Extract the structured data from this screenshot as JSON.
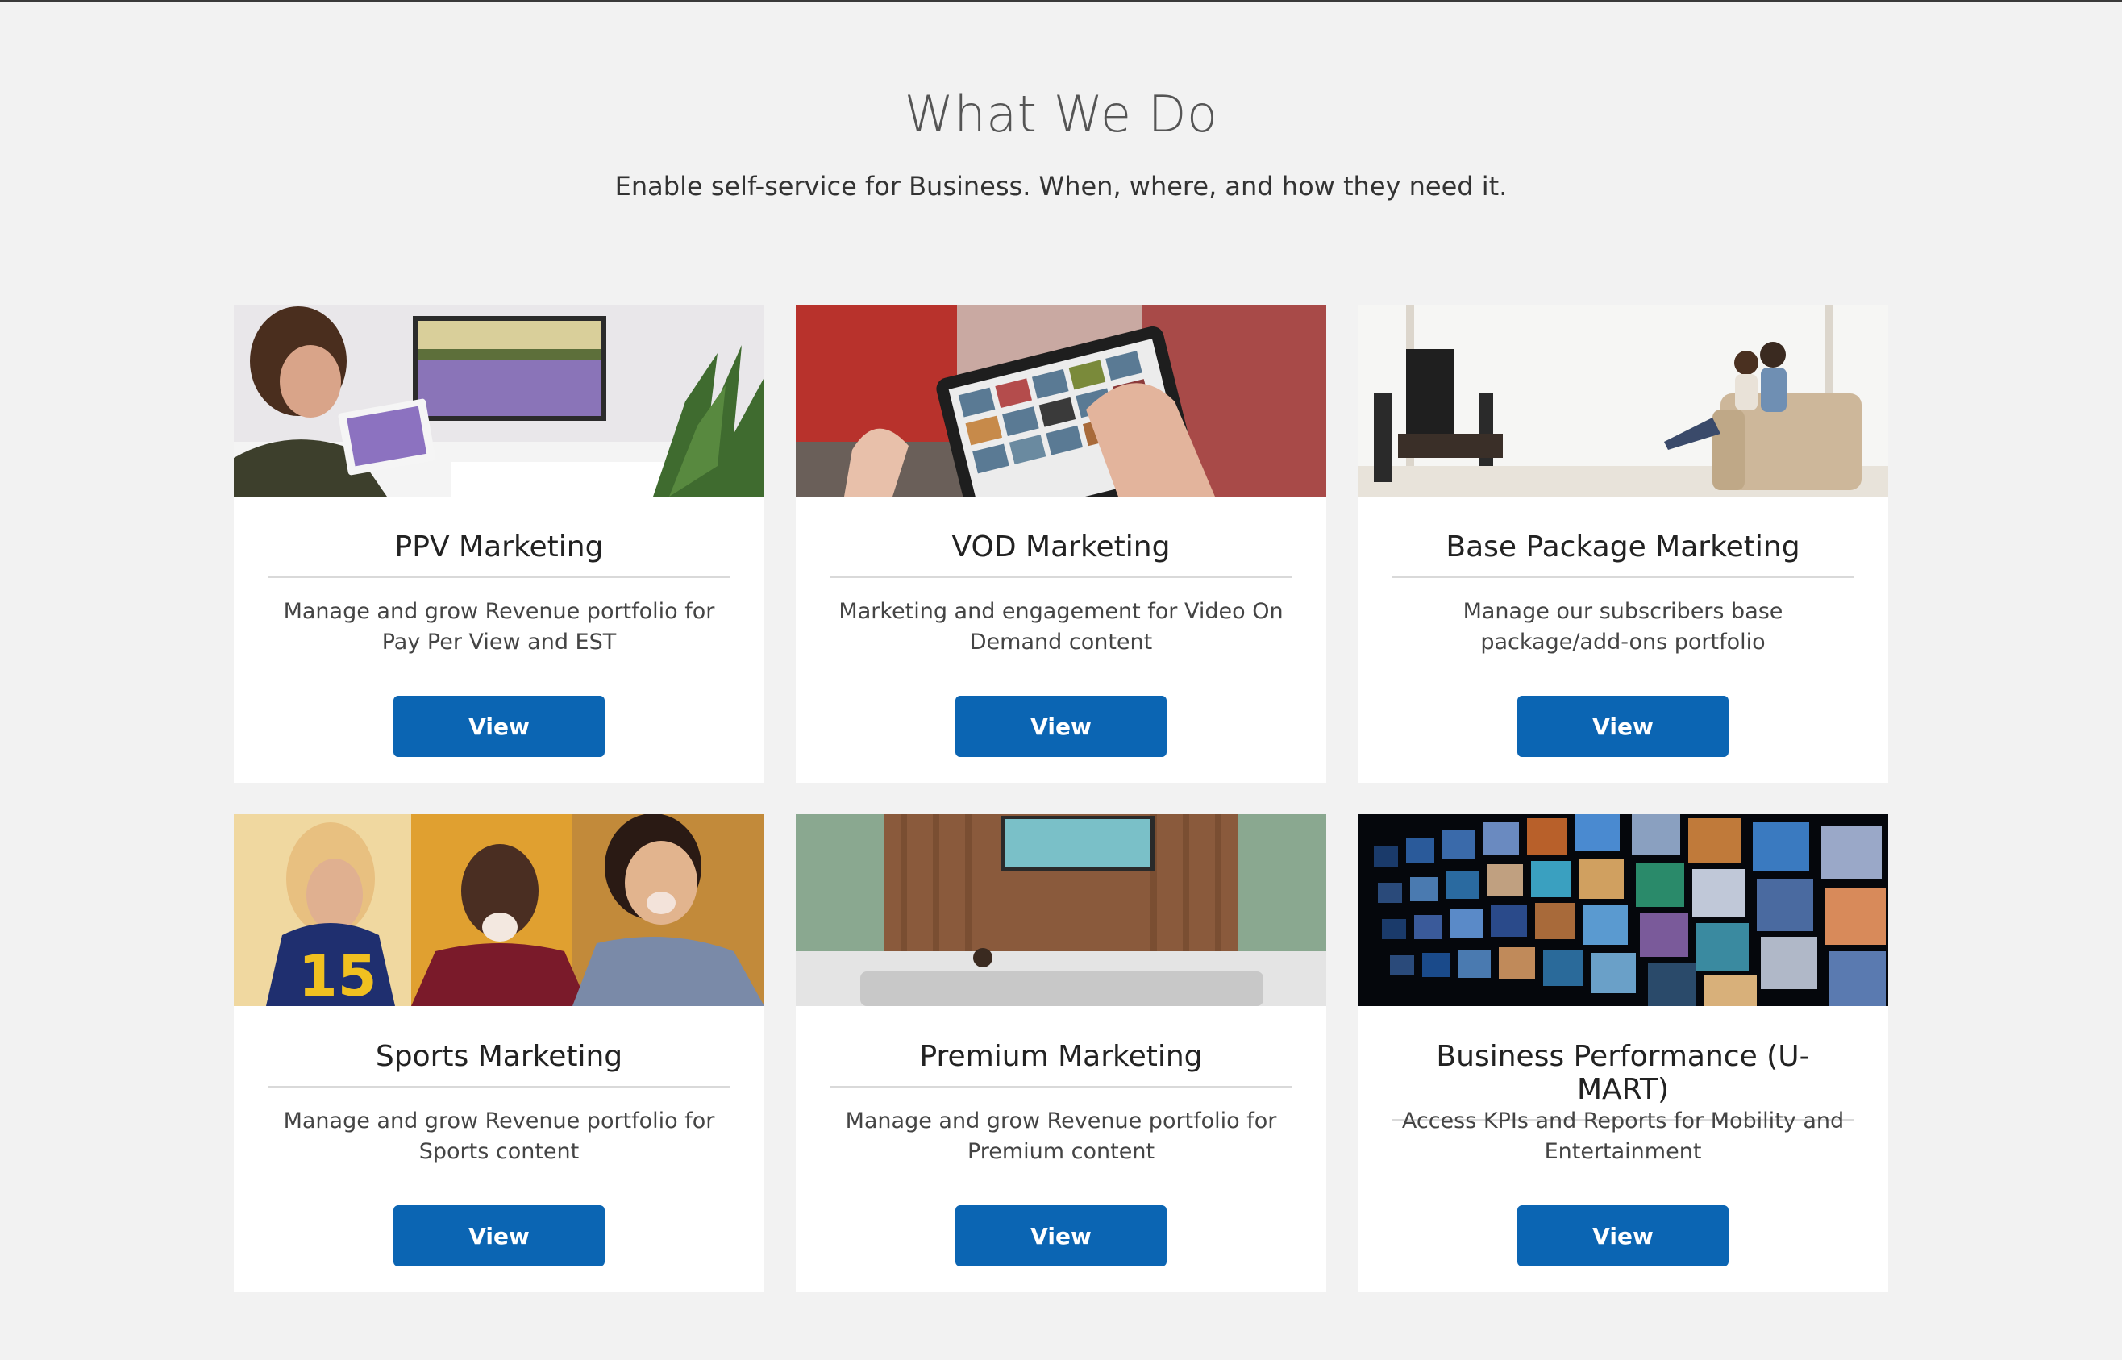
{
  "header": {
    "title": "What We Do",
    "subtitle": "Enable self-service for Business. When, where, and how they need it."
  },
  "cards": [
    {
      "title": "PPV Marketing",
      "description": "Manage and grow Revenue portfolio for Pay Per View and EST",
      "button_label": "View",
      "image": "woman-with-tablet-and-tv-image"
    },
    {
      "title": "VOD Marketing",
      "description": "Marketing and engagement for Video On Demand content",
      "button_label": "View",
      "image": "tablet-video-grid-image"
    },
    {
      "title": "Base Package Marketing",
      "description": "Manage our subscribers base package/add-ons portfolio",
      "button_label": "View",
      "image": "family-living-room-tv-image"
    },
    {
      "title": "Sports Marketing",
      "description": "Manage and grow Revenue portfolio for Sports content",
      "button_label": "View",
      "image": "cheering-sports-fans-image"
    },
    {
      "title": "Premium Marketing",
      "description": "Manage and grow Revenue portfolio for Premium content",
      "button_label": "View",
      "image": "modern-lounge-tv-image"
    },
    {
      "title": "Business Performance (U-MART)",
      "description": "Access KPIs and Reports for Mobility and Entertainment",
      "button_label": "View",
      "image": "video-wall-screens-image"
    }
  ],
  "colors": {
    "background": "#f2f2f2",
    "card": "#ffffff",
    "button": "#0b65b3",
    "button_text": "#ffffff"
  }
}
